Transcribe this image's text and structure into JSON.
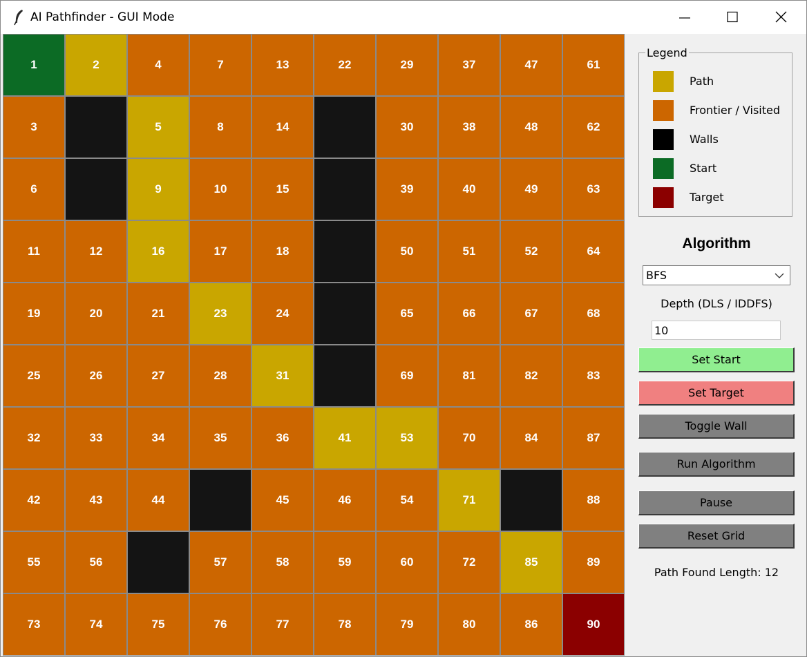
{
  "window": {
    "title": "AI Pathfinder - GUI Mode",
    "icons": {
      "app": "feather-icon",
      "minimize": "minimize-icon",
      "maximize": "maximize-icon",
      "close": "close-icon"
    }
  },
  "colors": {
    "path": "#c9a600",
    "visited": "#cc6600",
    "wall": "#141414",
    "start": "#0c6b25",
    "target": "#8b0000",
    "set_start_button": "#90ee90",
    "set_target_button": "#f08080",
    "default_button": "#808080"
  },
  "grid": {
    "rows": [
      [
        {
          "n": "1",
          "s": "start"
        },
        {
          "n": "2",
          "s": "path"
        },
        {
          "n": "4",
          "s": "visited"
        },
        {
          "n": "7",
          "s": "visited"
        },
        {
          "n": "13",
          "s": "visited"
        },
        {
          "n": "22",
          "s": "visited"
        },
        {
          "n": "29",
          "s": "visited"
        },
        {
          "n": "37",
          "s": "visited"
        },
        {
          "n": "47",
          "s": "visited"
        },
        {
          "n": "61",
          "s": "visited"
        }
      ],
      [
        {
          "n": "3",
          "s": "visited"
        },
        {
          "n": "",
          "s": "wall"
        },
        {
          "n": "5",
          "s": "path"
        },
        {
          "n": "8",
          "s": "visited"
        },
        {
          "n": "14",
          "s": "visited"
        },
        {
          "n": "",
          "s": "wall"
        },
        {
          "n": "30",
          "s": "visited"
        },
        {
          "n": "38",
          "s": "visited"
        },
        {
          "n": "48",
          "s": "visited"
        },
        {
          "n": "62",
          "s": "visited"
        }
      ],
      [
        {
          "n": "6",
          "s": "visited"
        },
        {
          "n": "",
          "s": "wall"
        },
        {
          "n": "9",
          "s": "path"
        },
        {
          "n": "10",
          "s": "visited"
        },
        {
          "n": "15",
          "s": "visited"
        },
        {
          "n": "",
          "s": "wall"
        },
        {
          "n": "39",
          "s": "visited"
        },
        {
          "n": "40",
          "s": "visited"
        },
        {
          "n": "49",
          "s": "visited"
        },
        {
          "n": "63",
          "s": "visited"
        }
      ],
      [
        {
          "n": "11",
          "s": "visited"
        },
        {
          "n": "12",
          "s": "visited"
        },
        {
          "n": "16",
          "s": "path"
        },
        {
          "n": "17",
          "s": "visited"
        },
        {
          "n": "18",
          "s": "visited"
        },
        {
          "n": "",
          "s": "wall"
        },
        {
          "n": "50",
          "s": "visited"
        },
        {
          "n": "51",
          "s": "visited"
        },
        {
          "n": "52",
          "s": "visited"
        },
        {
          "n": "64",
          "s": "visited"
        }
      ],
      [
        {
          "n": "19",
          "s": "visited"
        },
        {
          "n": "20",
          "s": "visited"
        },
        {
          "n": "21",
          "s": "visited"
        },
        {
          "n": "23",
          "s": "path"
        },
        {
          "n": "24",
          "s": "visited"
        },
        {
          "n": "",
          "s": "wall"
        },
        {
          "n": "65",
          "s": "visited"
        },
        {
          "n": "66",
          "s": "visited"
        },
        {
          "n": "67",
          "s": "visited"
        },
        {
          "n": "68",
          "s": "visited"
        }
      ],
      [
        {
          "n": "25",
          "s": "visited"
        },
        {
          "n": "26",
          "s": "visited"
        },
        {
          "n": "27",
          "s": "visited"
        },
        {
          "n": "28",
          "s": "visited"
        },
        {
          "n": "31",
          "s": "path"
        },
        {
          "n": "",
          "s": "wall"
        },
        {
          "n": "69",
          "s": "visited"
        },
        {
          "n": "81",
          "s": "visited"
        },
        {
          "n": "82",
          "s": "visited"
        },
        {
          "n": "83",
          "s": "visited"
        }
      ],
      [
        {
          "n": "32",
          "s": "visited"
        },
        {
          "n": "33",
          "s": "visited"
        },
        {
          "n": "34",
          "s": "visited"
        },
        {
          "n": "35",
          "s": "visited"
        },
        {
          "n": "36",
          "s": "visited"
        },
        {
          "n": "41",
          "s": "path"
        },
        {
          "n": "53",
          "s": "path"
        },
        {
          "n": "70",
          "s": "visited"
        },
        {
          "n": "84",
          "s": "visited"
        },
        {
          "n": "87",
          "s": "visited"
        }
      ],
      [
        {
          "n": "42",
          "s": "visited"
        },
        {
          "n": "43",
          "s": "visited"
        },
        {
          "n": "44",
          "s": "visited"
        },
        {
          "n": "",
          "s": "wall"
        },
        {
          "n": "45",
          "s": "visited"
        },
        {
          "n": "46",
          "s": "visited"
        },
        {
          "n": "54",
          "s": "visited"
        },
        {
          "n": "71",
          "s": "path"
        },
        {
          "n": "",
          "s": "wall"
        },
        {
          "n": "88",
          "s": "visited"
        }
      ],
      [
        {
          "n": "55",
          "s": "visited"
        },
        {
          "n": "56",
          "s": "visited"
        },
        {
          "n": "",
          "s": "wall"
        },
        {
          "n": "57",
          "s": "visited"
        },
        {
          "n": "58",
          "s": "visited"
        },
        {
          "n": "59",
          "s": "visited"
        },
        {
          "n": "60",
          "s": "visited"
        },
        {
          "n": "72",
          "s": "visited"
        },
        {
          "n": "85",
          "s": "path"
        },
        {
          "n": "89",
          "s": "visited"
        }
      ],
      [
        {
          "n": "73",
          "s": "visited"
        },
        {
          "n": "74",
          "s": "visited"
        },
        {
          "n": "75",
          "s": "visited"
        },
        {
          "n": "76",
          "s": "visited"
        },
        {
          "n": "77",
          "s": "visited"
        },
        {
          "n": "78",
          "s": "visited"
        },
        {
          "n": "79",
          "s": "visited"
        },
        {
          "n": "80",
          "s": "visited"
        },
        {
          "n": "86",
          "s": "visited"
        },
        {
          "n": "90",
          "s": "target"
        }
      ]
    ]
  },
  "legend": {
    "title": "Legend",
    "items": [
      {
        "label": "Path",
        "color": "#c9a600"
      },
      {
        "label": "Frontier / Visited",
        "color": "#cc6600"
      },
      {
        "label": "Walls",
        "color": "#000000"
      },
      {
        "label": "Start",
        "color": "#0c6b25"
      },
      {
        "label": "Target",
        "color": "#8b0000"
      }
    ]
  },
  "controls": {
    "algorithm_heading": "Algorithm",
    "algorithm_selected": "BFS",
    "depth_label": "Depth (DLS / IDDFS)",
    "depth_value": "10",
    "buttons": {
      "set_start": "Set Start",
      "set_target": "Set Target",
      "toggle_wall": "Toggle Wall",
      "run": "Run Algorithm",
      "pause": "Pause",
      "reset": "Reset Grid"
    },
    "status": "Path Found Length: 12"
  }
}
